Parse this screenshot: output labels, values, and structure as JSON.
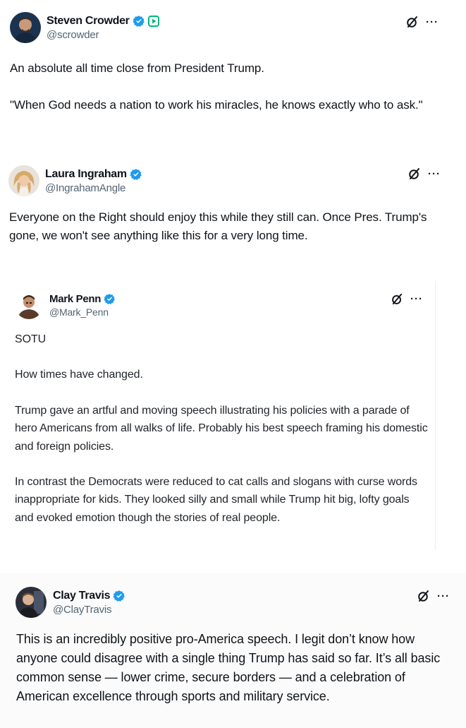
{
  "tweets": [
    {
      "display_name": "Steven Crowder",
      "handle": "@scrowder",
      "avatar_icon": "avatar-steven-crowder",
      "badges": [
        "verified-badge-icon",
        "subscription-play-icon"
      ],
      "paragraphs": [
        "An absolute all time close from President Trump.",
        "\"When God needs a nation to work his miracles, he knows exactly who to ask.\""
      ]
    },
    {
      "display_name": "Laura Ingraham",
      "handle": "@IngrahamAngle",
      "avatar_icon": "avatar-laura-ingraham",
      "badges": [
        "verified-badge-icon"
      ],
      "paragraphs": [
        "Everyone on the Right should enjoy this while they still can.  Once Pres. Trump's gone, we won't see anything like this for a very long time."
      ]
    },
    {
      "display_name": "Mark Penn",
      "handle": "@Mark_Penn",
      "avatar_icon": "avatar-mark-penn",
      "badges": [
        "verified-badge-icon"
      ],
      "paragraphs": [
        "SOTU",
        "How times have changed.",
        "Trump gave an artful and moving speech illustrating his policies with a parade of hero Americans from all walks of life. Probably his best speech framing his domestic and foreign policies.",
        "In contrast the Democrats were reduced to cat calls and slogans with curse words inappropriate for kids. They looked silly and small while Trump hit big, lofty goals and evoked emotion though the stories of real people."
      ]
    },
    {
      "display_name": "Clay Travis",
      "handle": "@ClayTravis",
      "avatar_icon": "avatar-clay-travis",
      "badges": [
        "verified-badge-icon"
      ],
      "paragraphs": [
        "This is an incredibly positive pro-America speech. I legit don’t know how anyone could disagree with a single thing Trump has said so far. It’s all basic common sense — lower crime, secure borders — and a celebration of American excellence through sports and military service."
      ]
    }
  ],
  "common": {
    "grok_icon": "grok-icon",
    "more_label": "···",
    "verified_color": "#1d9bf0",
    "subscription_color": "#00ba7c"
  }
}
